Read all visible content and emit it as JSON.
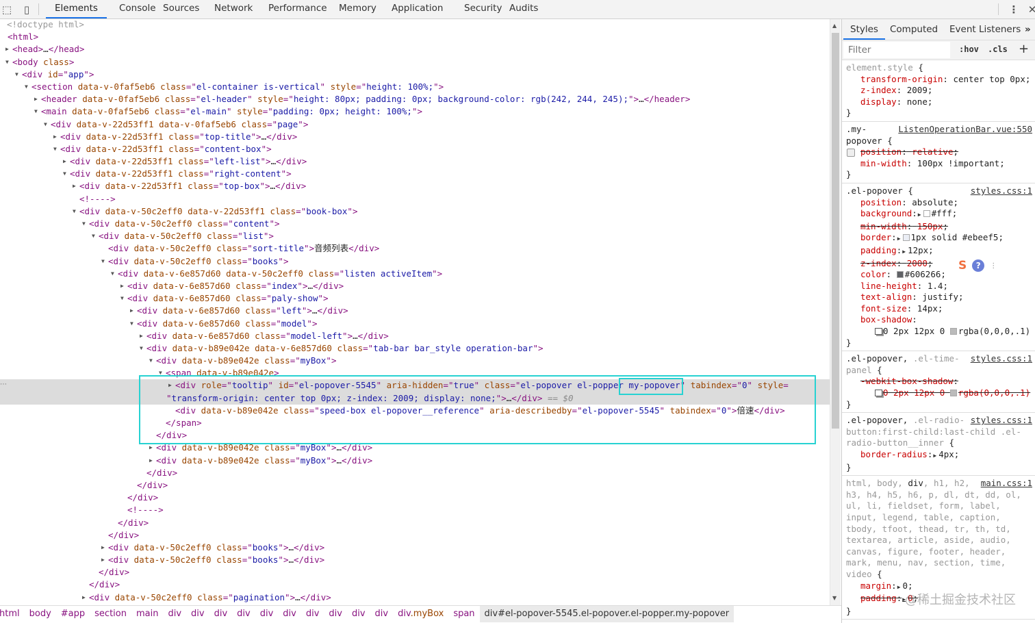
{
  "toolbar": {
    "tabs": [
      "Elements",
      "Console",
      "Sources",
      "Network",
      "Performance",
      "Memory",
      "Application",
      "Security",
      "Audits"
    ],
    "active_tab": "Elements",
    "icons": [
      "inspect-element-icon",
      "device-toolbar-icon",
      "more-options-icon",
      "close-icon"
    ]
  },
  "dom_tree": {
    "lines": [
      {
        "depth": 0,
        "arrow": "",
        "kind": "doctype",
        "text": "<!doctype html>"
      },
      {
        "depth": 0,
        "arrow": "",
        "text": "<html>"
      },
      {
        "depth": 0,
        "arrow": "collapsed",
        "text": "<head>…</head>"
      },
      {
        "depth": 0,
        "arrow": "expanded",
        "text": "<body class>"
      },
      {
        "depth": 1,
        "arrow": "expanded",
        "text": "<div id=\"app\">"
      },
      {
        "depth": 2,
        "arrow": "expanded",
        "text": "<section data-v-0faf5eb6 class=\"el-container is-vertical\" style=\"height: 100%;\">"
      },
      {
        "depth": 3,
        "arrow": "collapsed",
        "text": "<header data-v-0faf5eb6 class=\"el-header\" style=\"height: 80px; padding: 0px; background-color: rgb(242, 244, 245);\">…</header>"
      },
      {
        "depth": 3,
        "arrow": "expanded",
        "text": "<main data-v-0faf5eb6 class=\"el-main\" style=\"padding: 0px; height: 100%;\">"
      },
      {
        "depth": 4,
        "arrow": "expanded",
        "text": "<div data-v-22d53ff1 data-v-0faf5eb6 class=\"page\">"
      },
      {
        "depth": 5,
        "arrow": "collapsed",
        "text": "<div data-v-22d53ff1 class=\"top-title\">…</div>"
      },
      {
        "depth": 5,
        "arrow": "expanded",
        "text": "<div data-v-22d53ff1 class=\"content-box\">"
      },
      {
        "depth": 6,
        "arrow": "collapsed",
        "text": "<div data-v-22d53ff1 class=\"left-list\">…</div>"
      },
      {
        "depth": 6,
        "arrow": "expanded",
        "text": "<div data-v-22d53ff1 class=\"right-content\">"
      },
      {
        "depth": 7,
        "arrow": "collapsed",
        "text": "<div data-v-22d53ff1 class=\"top-box\">…</div>"
      },
      {
        "depth": 7,
        "arrow": "",
        "kind": "comment",
        "text": "<!---->"
      },
      {
        "depth": 7,
        "arrow": "expanded",
        "text": "<div data-v-50c2eff0 data-v-22d53ff1 class=\"book-box\">"
      },
      {
        "depth": 8,
        "arrow": "expanded",
        "text": "<div data-v-50c2eff0 class=\"content\">"
      },
      {
        "depth": 9,
        "arrow": "expanded",
        "text": "<div data-v-50c2eff0 class=\"list\">"
      },
      {
        "depth": 10,
        "arrow": "",
        "text": "<div data-v-50c2eff0 class=\"sort-title\">音频列表</div>"
      },
      {
        "depth": 10,
        "arrow": "expanded",
        "text": "<div data-v-50c2eff0 class=\"books\">"
      },
      {
        "depth": 11,
        "arrow": "expanded",
        "text": "<div data-v-6e857d60 data-v-50c2eff0 class=\"listen activeItem\">"
      },
      {
        "depth": 12,
        "arrow": "collapsed",
        "text": "<div data-v-6e857d60 class=\"index\">…</div>"
      },
      {
        "depth": 12,
        "arrow": "expanded",
        "text": "<div data-v-6e857d60 class=\"paly-show\">"
      },
      {
        "depth": 13,
        "arrow": "collapsed",
        "text": "<div data-v-6e857d60 class=\"left\">…</div>"
      },
      {
        "depth": 13,
        "arrow": "expanded",
        "text": "<div data-v-6e857d60 class=\"model\">"
      },
      {
        "depth": 14,
        "arrow": "collapsed",
        "text": "<div data-v-6e857d60 class=\"model-left\">…</div>"
      },
      {
        "depth": 14,
        "arrow": "expanded",
        "text": "<div data-v-b89e042e data-v-6e857d60 class=\"tab-bar bar_style operation-bar\">"
      },
      {
        "depth": 15,
        "arrow": "expanded",
        "text": "<div data-v-b89e042e class=\"myBox\">"
      },
      {
        "depth": 16,
        "arrow": "expanded",
        "text": "<span data-v-b89e042e>"
      },
      {
        "depth": 17,
        "arrow": "collapsed",
        "selected": true,
        "text": "<div role=\"tooltip\" id=\"el-popover-5545\" aria-hidden=\"true\" class=\"el-popover el-popper my-popover\" tabindex=\"0\" style="
      },
      {
        "depth": 17,
        "arrow": "",
        "selected": true,
        "continuation": true,
        "text": "\"transform-origin: center top 0px; z-index: 2009; display: none;\">…</div>",
        "marker": " == $0"
      },
      {
        "depth": 17,
        "arrow": "",
        "text": "<div data-v-b89e042e class=\"speed-box el-popover__reference\" aria-describedby=\"el-popover-5545\" tabindex=\"0\">倍速</div>"
      },
      {
        "depth": 16,
        "arrow": "",
        "text": "</span>"
      },
      {
        "depth": 15,
        "arrow": "",
        "text": "</div>"
      },
      {
        "depth": 15,
        "arrow": "collapsed",
        "text": "<div data-v-b89e042e class=\"myBox\">…</div>"
      },
      {
        "depth": 15,
        "arrow": "collapsed",
        "text": "<div data-v-b89e042e class=\"myBox\">…</div>"
      },
      {
        "depth": 14,
        "arrow": "",
        "text": "</div>"
      },
      {
        "depth": 13,
        "arrow": "",
        "text": "</div>"
      },
      {
        "depth": 12,
        "arrow": "",
        "text": "</div>"
      },
      {
        "depth": 12,
        "arrow": "",
        "kind": "comment",
        "text": "<!---->"
      },
      {
        "depth": 11,
        "arrow": "",
        "text": "</div>"
      },
      {
        "depth": 10,
        "arrow": "",
        "text": "</div>"
      },
      {
        "depth": 10,
        "arrow": "collapsed",
        "text": "<div data-v-50c2eff0 class=\"books\">…</div>"
      },
      {
        "depth": 10,
        "arrow": "collapsed",
        "text": "<div data-v-50c2eff0 class=\"books\">…</div>"
      },
      {
        "depth": 9,
        "arrow": "",
        "text": "</div>"
      },
      {
        "depth": 8,
        "arrow": "",
        "text": "</div>"
      },
      {
        "depth": 8,
        "arrow": "collapsed",
        "text": "<div data-v-50c2eff0 class=\"pagination\">…</div>"
      }
    ],
    "highlight_color": "#27d2d2"
  },
  "breadcrumb": [
    {
      "tag": "html",
      "cls": ""
    },
    {
      "tag": "body",
      "cls": ""
    },
    {
      "tag": "#app",
      "cls": ""
    },
    {
      "tag": "section",
      "cls": ""
    },
    {
      "tag": "main",
      "cls": ""
    },
    {
      "tag": "div",
      "cls": ""
    },
    {
      "tag": "div",
      "cls": ""
    },
    {
      "tag": "div",
      "cls": ""
    },
    {
      "tag": "div",
      "cls": ""
    },
    {
      "tag": "div",
      "cls": ""
    },
    {
      "tag": "div",
      "cls": ""
    },
    {
      "tag": "div",
      "cls": ""
    },
    {
      "tag": "div",
      "cls": ""
    },
    {
      "tag": "div",
      "cls": ""
    },
    {
      "tag": "div",
      "cls": ""
    },
    {
      "tag": "div",
      "cls": ".myBox"
    },
    {
      "tag": "span",
      "cls": ""
    },
    {
      "tag": "div#el-popover-5545.el-popover.el-popper.my-popover",
      "cls": "",
      "selected": true
    }
  ],
  "sidebar": {
    "tabs": [
      "Styles",
      "Computed",
      "Event Listeners"
    ],
    "active_tab": "Styles",
    "more": "»",
    "filter_placeholder": "Filter",
    "hov": ":hov",
    "cls": ".cls",
    "add": "+",
    "rules": [
      {
        "selector": [
          {
            "text": "element.style",
            "match": true,
            "muted": true
          }
        ],
        "source": "",
        "props": [
          {
            "name": "transform-origin",
            "value": "center top 0px"
          },
          {
            "name": "z-index",
            "value": "2009"
          },
          {
            "name": "display",
            "value": "none"
          }
        ]
      },
      {
        "selector": [
          {
            "text": ".my-popover",
            "match": true
          }
        ],
        "source": "ListenOperationBar.vue:550",
        "props": [
          {
            "name": "position",
            "value": "relative",
            "struck": true,
            "checkbox": true
          },
          {
            "name": "min-width",
            "value": "100px !important"
          }
        ]
      },
      {
        "selector": [
          {
            "text": ".el-popover",
            "match": true
          }
        ],
        "source": "styles.css:1",
        "props": [
          {
            "name": "position",
            "value": "absolute"
          },
          {
            "name": "background",
            "value": "#fff",
            "expander": true,
            "swatch": "#ffffff"
          },
          {
            "name": "min-width",
            "value": "150px",
            "struck": true
          },
          {
            "name": "border",
            "value": "1px solid #ebeef5",
            "expander": true,
            "swatch": "#ebeef5"
          },
          {
            "name": "padding",
            "value": "12px",
            "expander": true
          },
          {
            "name": "z-index",
            "value": "2000",
            "struck": true
          },
          {
            "name": "color",
            "value": "#606266",
            "swatch": "#606266"
          },
          {
            "name": "line-height",
            "value": "1.4"
          },
          {
            "name": "text-align",
            "value": "justify"
          },
          {
            "name": "font-size",
            "value": "14px"
          },
          {
            "name": "box-shadow",
            "value": "0 2px 12px 0 rgba(0,0,0,.1)",
            "shadow": true,
            "swatch": "#bbbbbb",
            "wrap": true
          }
        ]
      },
      {
        "selector": [
          {
            "text": ".el-popover",
            "match": true
          },
          {
            "text": ", ",
            "match": true
          },
          {
            "text": ".el-time-panel",
            "match": false
          }
        ],
        "source": "styles.css:1",
        "props": [
          {
            "name": "-webkit-box-shadow",
            "value": "0 2px 12px 0 rgba(0,0,0,.1)",
            "struck": true,
            "shadow": true,
            "swatch": "#bbbbbb",
            "wrap": true
          }
        ]
      },
      {
        "selector": [
          {
            "text": ".el-popover",
            "match": true
          },
          {
            "text": ", ",
            "match": true
          },
          {
            "text": ".el-radio-button:first-child:last-child .el-radio-button__inner",
            "match": false
          }
        ],
        "source": "styles.css:1",
        "props": [
          {
            "name": "border-radius",
            "value": "4px",
            "expander": true
          }
        ]
      },
      {
        "selector": [
          {
            "text": "html, body, ",
            "match": false
          },
          {
            "text": "div",
            "match": true
          },
          {
            "text": ", h1, h2, h3, h4, h5, h6, p, dl, dt, dd, ol, ul, li, fieldset, form, label, input, legend, table, caption, tbody, tfoot, thead, tr, th, td, textarea, article, aside, audio, canvas, figure, footer, header, mark, menu, nav, section, time, video",
            "match": false
          }
        ],
        "source": "main.css:1",
        "props": [
          {
            "name": "margin",
            "value": "0",
            "expander": true
          },
          {
            "name": "padding",
            "value": "0",
            "expander": true,
            "struck": true
          }
        ]
      }
    ]
  },
  "watermark": "@稀土掘金技术社区"
}
